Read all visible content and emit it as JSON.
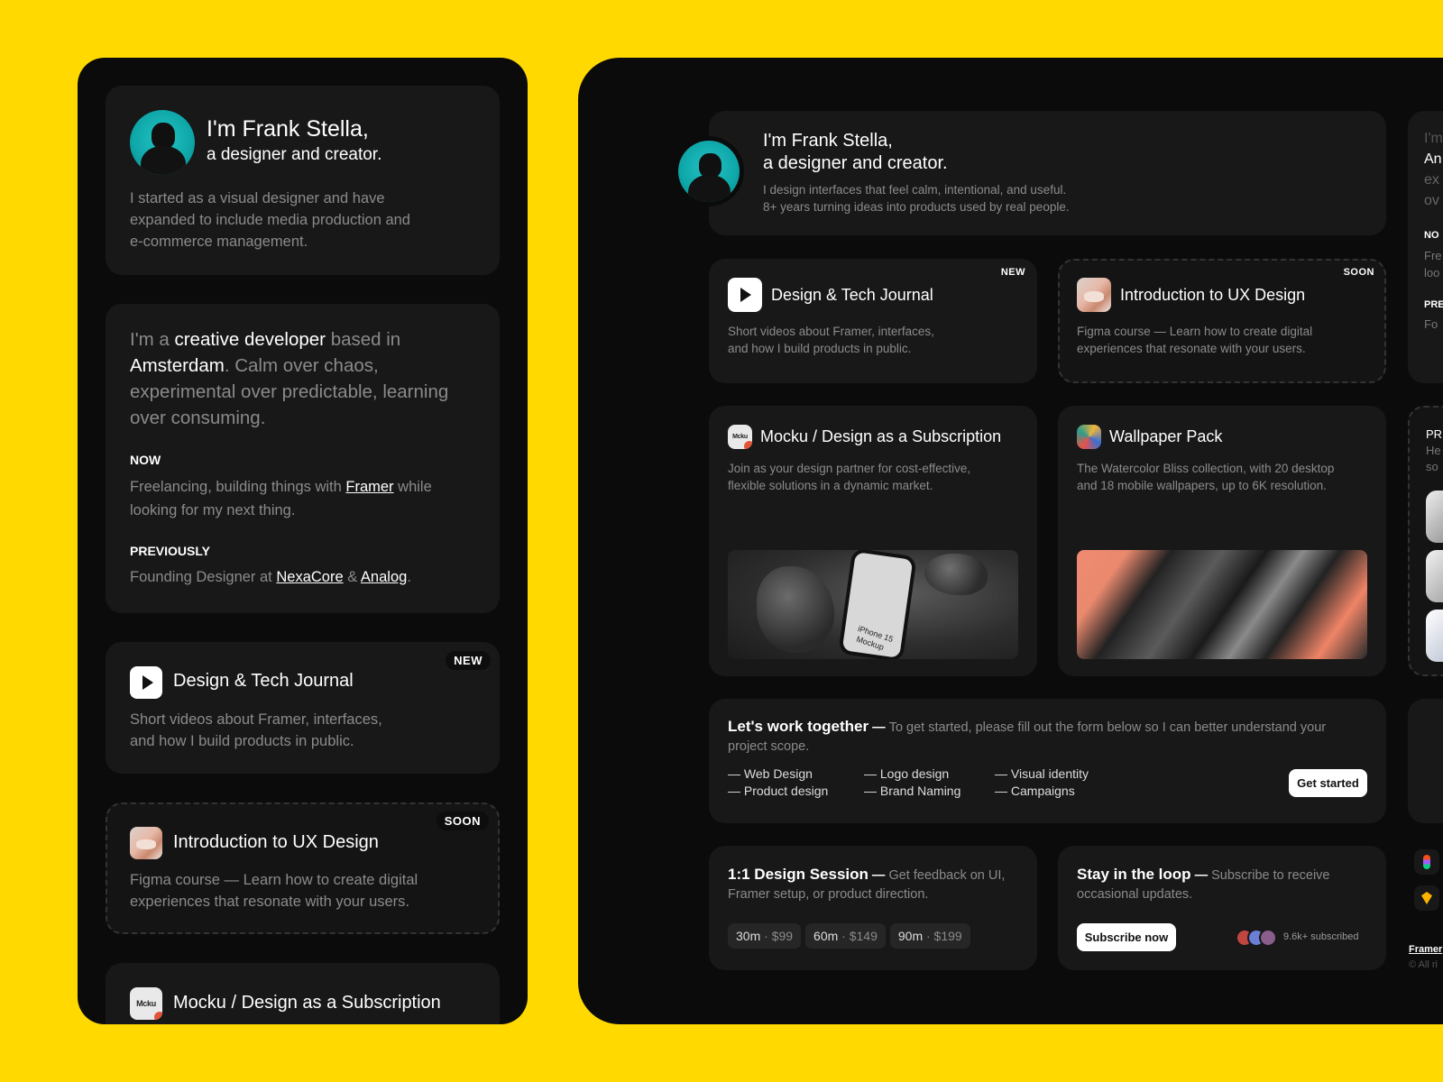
{
  "intro": {
    "name_line": "I'm Frank Stella,",
    "role_line": "a designer and creator.",
    "mobile_bio": "I started as a visual designer and have expanded to include media production and e-commerce management.",
    "desktop_bio_1": "I design interfaces that feel calm, intentional, and useful.",
    "desktop_bio_2": "8+ years turning ideas into products used by real people."
  },
  "about": {
    "p1": "I'm a ",
    "p1_hl": "creative developer",
    "p2": " based in ",
    "p2_hl": "Amsterdam",
    "p3": ". Calm over chaos, experimental over predictable, learning over consuming.",
    "now_label": "NOW",
    "now_text_1": "Freelancing, building things with ",
    "now_link": "Framer",
    "now_text_2": " while looking for my next thing.",
    "prev_label": "PREVIOUSLY",
    "prev_text_1": "Founding Designer at ",
    "prev_link_1": "NexaCore",
    "prev_amp": " & ",
    "prev_link_2": "Analog",
    "prev_dot": "."
  },
  "journal": {
    "title": "Design & Tech Journal",
    "badge": "NEW",
    "desc_1": "Short videos about Framer, interfaces,",
    "desc_2": "and how I build products in public."
  },
  "ux_course": {
    "title": "Introduction to UX Design",
    "badge": "SOON",
    "desc_1": "Figma course — Learn how to create digital",
    "desc_2": "experiences that resonate with your users."
  },
  "mocku": {
    "title": "Mocku / Design as a Subscription",
    "icon_text": "Mcku",
    "desc_1": "Join as your design partner for cost-effective,",
    "desc_2": "flexible solutions in a dynamic market.",
    "phone_text_1": "iPhone 15",
    "phone_text_2": "Mockup"
  },
  "wallpaper": {
    "title": "Wallpaper Pack",
    "desc_1": "The Watercolor Bliss collection, with 20 desktop",
    "desc_2": "and 18 mobile wallpapers, up to 6K resolution."
  },
  "work": {
    "title": "Let's work together",
    "dash": " — ",
    "desc": "To get started, please fill out the form below so I can better understand your project scope.",
    "services": [
      "— Web Design",
      "— Product design",
      "— Logo design",
      "— Brand Naming",
      "— Visual identity",
      "— Campaigns"
    ],
    "cta": "Get started"
  },
  "session": {
    "title": "1:1 Design Session",
    "dash": " — ",
    "desc": "Get feedback on UI, Framer setup, or product direction.",
    "options": [
      {
        "time": "30m",
        "price": "· $99"
      },
      {
        "time": "60m",
        "price": "· $149"
      },
      {
        "time": "90m",
        "price": "· $199"
      }
    ]
  },
  "newsletter": {
    "title": "Stay in the loop",
    "dash": " — ",
    "desc": "Subscribe to receive occasional updates.",
    "cta": "Subscribe now",
    "count": "9.6k+ subscribed"
  },
  "peek": {
    "lines": [
      "I'm",
      "An",
      "ex",
      "ov"
    ],
    "now": "NO",
    "now_lines": [
      "Fre",
      "loo"
    ],
    "prev": "PRE",
    "prev_line": "Fo",
    "pr_label": "PR",
    "pr_lines": [
      "He",
      "so"
    ],
    "footer_link": "Framer",
    "footer_copy": "© All ri"
  },
  "colors": {
    "background": "#FFD900",
    "panel": "#0b0b0b",
    "card": "#181818",
    "accent_avatar": "#0fa7a9"
  }
}
